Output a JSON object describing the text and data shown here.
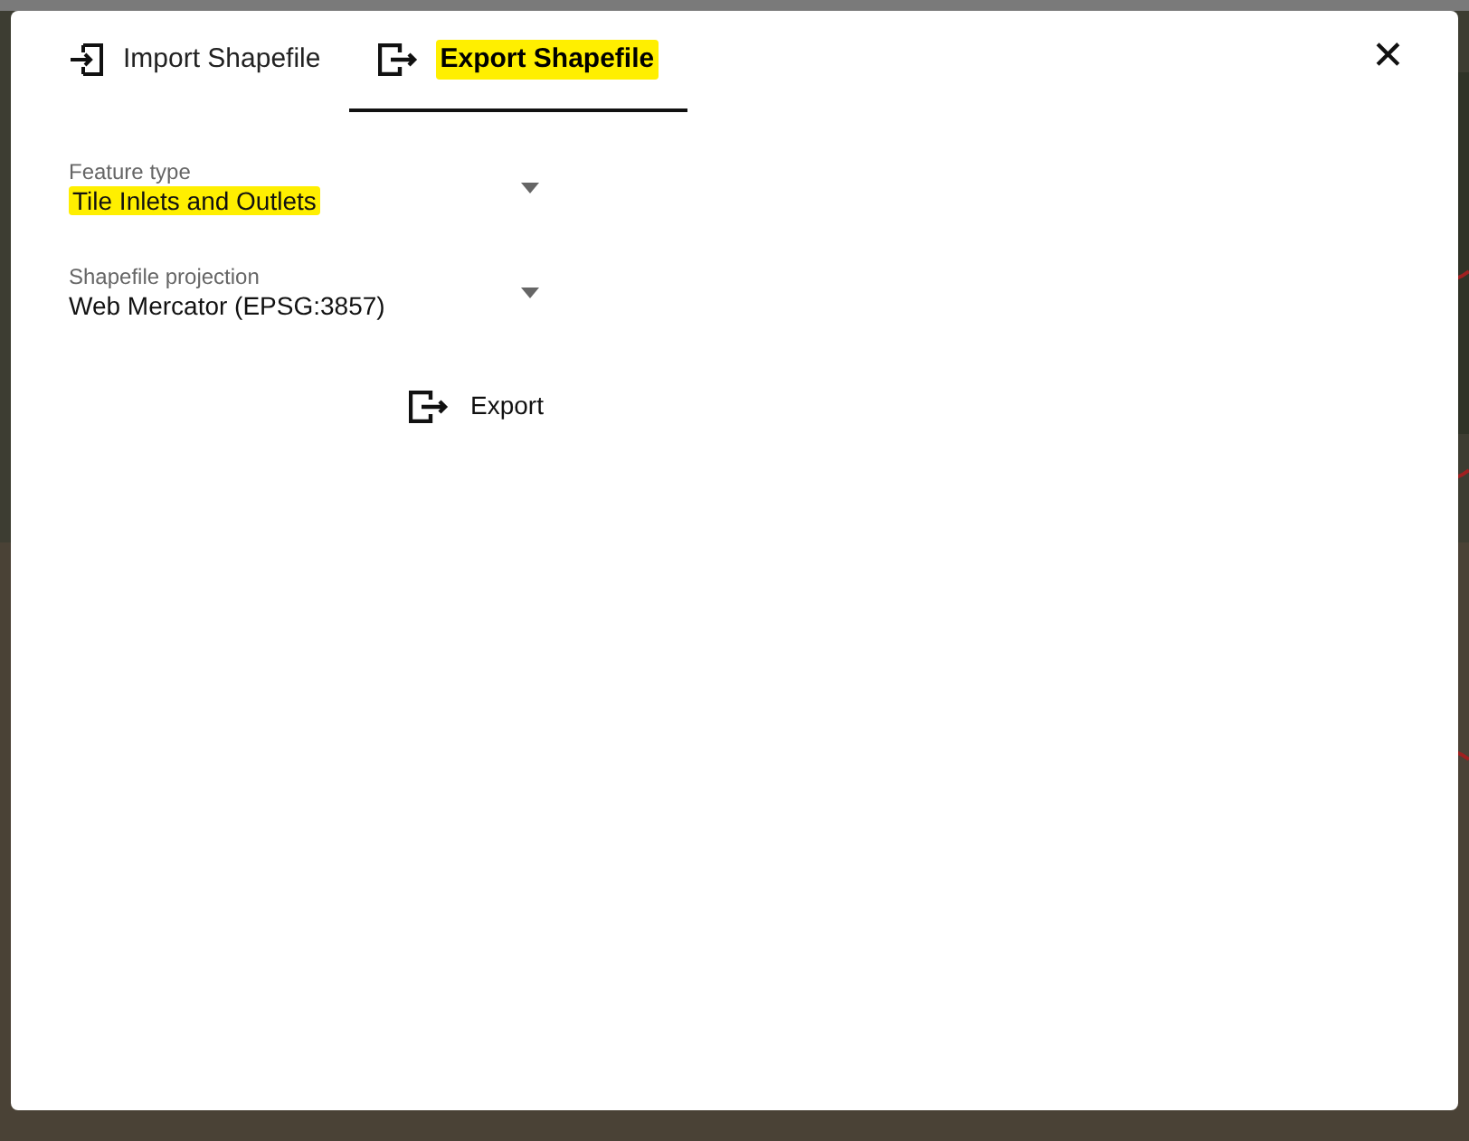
{
  "dialog": {
    "tabs": [
      {
        "label": "Import Shapefile",
        "kind": "import",
        "selected": false,
        "highlighted": false
      },
      {
        "label": "Export Shapefile",
        "kind": "export",
        "selected": true,
        "highlighted": true
      }
    ],
    "close": "✕",
    "fields": [
      {
        "label": "Feature type",
        "value": "Tile Inlets and Outlets",
        "highlighted": true
      },
      {
        "label": "Shapefile projection",
        "value": "Web Mercator (EPSG:3857)",
        "highlighted": false
      }
    ],
    "export_button": "Export"
  }
}
